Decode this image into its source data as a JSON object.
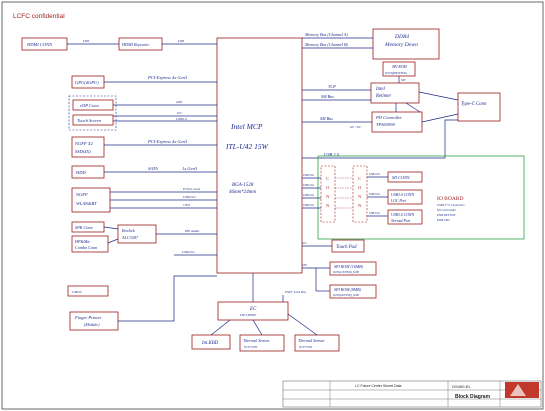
{
  "header": {
    "confidential": "LCFC confidential"
  },
  "cpu": {
    "title": "Intel  MCP",
    "model": "ITL-U42 15W",
    "package": "BGA-1528",
    "size": "46mm*24mm"
  },
  "blocks": {
    "hdmi_conn": "HDMI CONN",
    "hdmi_repeater": "HDMI Repeater",
    "ddr4": "DDR4",
    "memory_down": "Memory Down",
    "spi_rom_top": "SPI ROM",
    "spi_rom_top_part": "W25Q80DVSSIG",
    "gpu": "GPU(dGPU)",
    "edp_conn": "eDP Conn",
    "touch_screen": "Touch Screen",
    "intel_retimer": "Intel",
    "intel_retimer_2": "Retimer",
    "pd_controller": "PD Controller",
    "pd_part": "TPS65994",
    "type_c_conn": "Type-C Conn",
    "ngff_x2": "NGFF X2",
    "ssd": "SSD(4X)",
    "hdd": "HDD",
    "ngff_wlan": "NGFF",
    "wlan_bt": "WLAN&BT",
    "cmos": "CMOS",
    "spk_conn": "SPK Conn",
    "hp_mic": "HP&Mic",
    "combo_conn": "Combo Conn",
    "realtek": "Realtek",
    "alc": "ALC3287",
    "sd_conn": "SD CONN",
    "usb_conn_1": "USB3.0 CONN",
    "usb_conn_1_sub": "LOC Port",
    "usb_conn_2": "USB3.0 CONN",
    "usb_conn_2_sub": "Normal Port",
    "conn_letters": [
      "C",
      "O",
      "N",
      "N"
    ],
    "io_board": "IO BOARD",
    "io_board_items": [
      "USB3.0 *2 Connectors",
      "SD Card reader",
      "PWR BUTTON",
      "PWR LED"
    ],
    "touch_pad": "Touch Pad",
    "spi_rom_a": "SPI ROM (16MB)",
    "spi_rom_a_part": "W25Q128JVSIQ_SOI8",
    "spi_rom_b": "SPI ROM (8MB)",
    "spi_rom_b_part": "W25Q64JVSSIQ_SOI8",
    "tpm": "TPM  Controller",
    "finger_printer": "Finger Printer",
    "finger_module": "(Module)",
    "ec": "EC",
    "ec_part": "ITE IT8987",
    "int_kbd": "Int.KBD",
    "thermal_1": "Thermal Sensor",
    "thermal_1_part": "NCT7718W",
    "thermal_2": "Thermal Sensor",
    "thermal_2_part": "NCT7718W"
  },
  "signals": {
    "ddi_left": "DDI",
    "ddi_right": "DDI",
    "mem_a": "Memory Bus (Channel A)",
    "mem_b": "Memory Bus (Channel B)",
    "spi": "SPI",
    "pcie_gpu": "PCI-Express  4x Gen3",
    "tcp": "TCP",
    "sm_bus_1": "SM Bus",
    "edp": "eDP",
    "i2c_1": "I2C",
    "usb2_1": "USB2.0",
    "sm_bus_2": "SM Bus",
    "i2c_pd": "I2C / I2C",
    "pcie_ssd": "PCI-Express  4x Gen3",
    "usb_20": "USB 2.0",
    "sata": "SATA",
    "sata_gen": "1x Gen3",
    "usb3_a": "USB3.0x1",
    "usb3_b": "USB2.0x1",
    "usb3_c": "USB3.0x1",
    "usb3_d": "USB2.0x1",
    "pcie_wlan": "PCIex1 Gen2",
    "usb_wlan": "USB2.0x1",
    "cnvi": "CNVi",
    "hd_audio": "HD Audio",
    "usb_fp": "USB2.0x1",
    "i2c_tp": "I2C",
    "spi_2": "SPI",
    "espi": "ESPI / Lock Bus",
    "usb_sd": "USB2.0x1",
    "usb_io_1": "USB3.0x1",
    "usb_io_2": "USB3.0x1"
  },
  "footer": {
    "company": "LC Future Center Secret Data",
    "title": "Block  Diagram",
    "board": "GS450-EL"
  },
  "colors": {
    "border": "#9b1c1c",
    "wire": "#1c2a8a",
    "io_box": "#2fa34a",
    "logo": "#c0392b"
  }
}
